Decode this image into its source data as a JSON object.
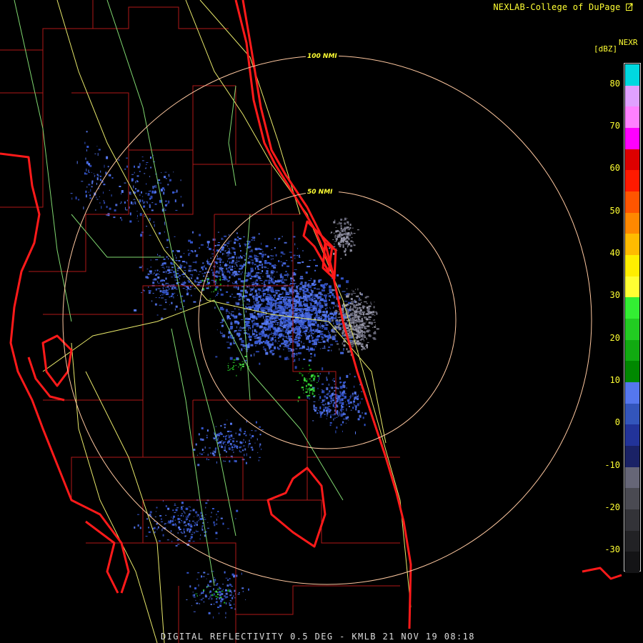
{
  "header": {
    "credit": "NEXLAB-College of DuPage",
    "product": "NEXR",
    "units": "[dBZ]"
  },
  "legend": {
    "ticks": [
      "80",
      "70",
      "60",
      "50",
      "40",
      "30",
      "20",
      "10",
      "0",
      "-10",
      "-20",
      "-30"
    ],
    "color_stops": [
      {
        "from": 85,
        "to": 80,
        "color": "#00d8e0"
      },
      {
        "from": 80,
        "to": 75,
        "color": "#e0a0ff"
      },
      {
        "from": 75,
        "to": 70,
        "color": "#ff80ff"
      },
      {
        "from": 70,
        "to": 65,
        "color": "#ff00ff"
      },
      {
        "from": 65,
        "to": 60,
        "color": "#dd0000"
      },
      {
        "from": 60,
        "to": 55,
        "color": "#ff1a00"
      },
      {
        "from": 55,
        "to": 50,
        "color": "#ff5500"
      },
      {
        "from": 50,
        "to": 45,
        "color": "#ff8800"
      },
      {
        "from": 45,
        "to": 40,
        "color": "#ffbb00"
      },
      {
        "from": 40,
        "to": 35,
        "color": "#ffee00"
      },
      {
        "from": 35,
        "to": 30,
        "color": "#ffff33"
      },
      {
        "from": 30,
        "to": 25,
        "color": "#33ee33"
      },
      {
        "from": 25,
        "to": 20,
        "color": "#22cc22"
      },
      {
        "from": 20,
        "to": 15,
        "color": "#11aa11"
      },
      {
        "from": 15,
        "to": 10,
        "color": "#008800"
      },
      {
        "from": 10,
        "to": 5,
        "color": "#5577ee"
      },
      {
        "from": 5,
        "to": 0,
        "color": "#3355bb"
      },
      {
        "from": 0,
        "to": -5,
        "color": "#223399"
      },
      {
        "from": -5,
        "to": -10,
        "color": "#1a2266"
      },
      {
        "from": -10,
        "to": -15,
        "color": "#666677"
      },
      {
        "from": -15,
        "to": -20,
        "color": "#4a4a52"
      },
      {
        "from": -20,
        "to": -25,
        "color": "#333338"
      },
      {
        "from": -25,
        "to": -30,
        "color": "#222225"
      },
      {
        "from": -30,
        "to": -35,
        "color": "#141416"
      }
    ]
  },
  "range_rings": [
    {
      "label": "100 NMI"
    },
    {
      "label": "50 NMI"
    }
  ],
  "footer": {
    "caption": "DIGITAL REFLECTIVITY 0.5 DEG - KMLB 21 NOV 19 08:18"
  },
  "colors": {
    "background": "#000000",
    "coastline": "#ff1a1a",
    "county_lines": "#b01818",
    "highways": "#e8e86a",
    "roads": "#80d870",
    "range_ring": "#ffc8a0",
    "label_yellow": "#ffff33",
    "weak_echo_blue": "#4466dd",
    "clutter_gray": "#777788",
    "light_green": "#22bb22"
  },
  "radar_site": "KMLB"
}
